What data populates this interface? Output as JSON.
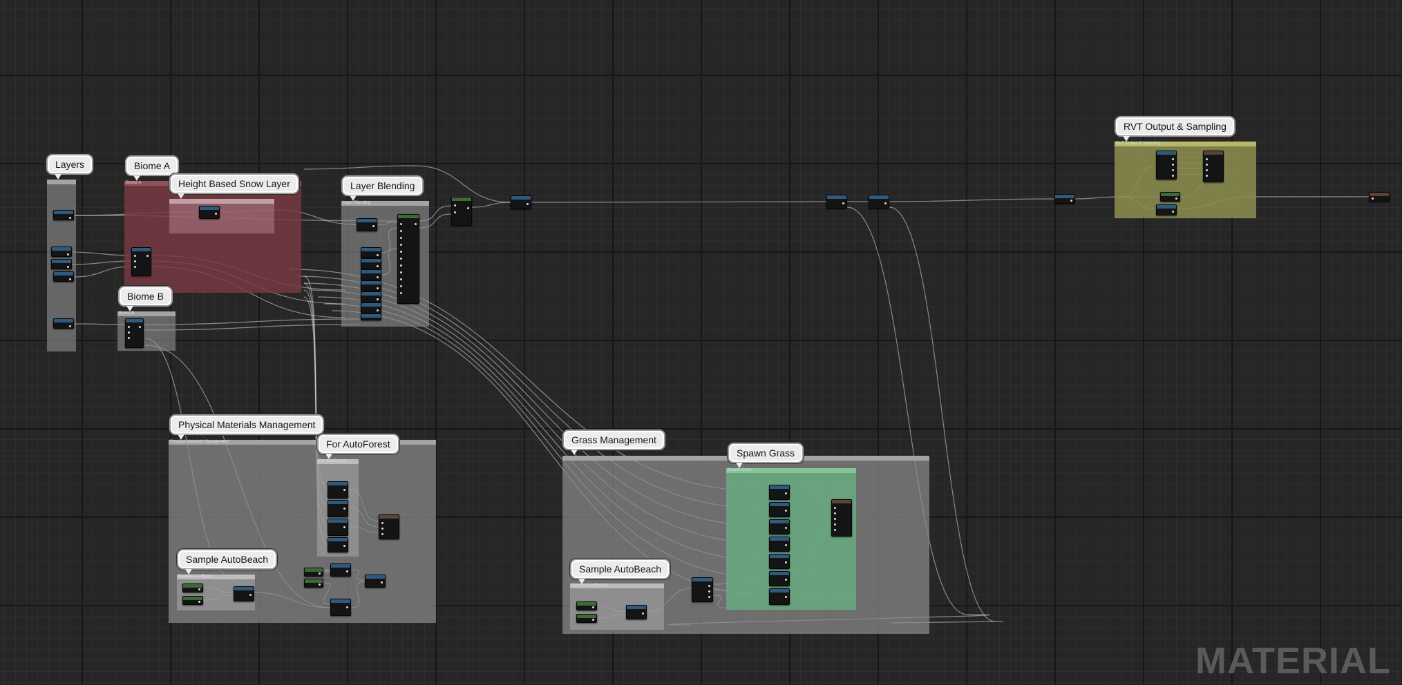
{
  "comments": [
    {
      "key": "layers",
      "label": "Layers",
      "tab_text": ""
    },
    {
      "key": "biome_a",
      "label": "Biome A",
      "tab_text": "Biome A"
    },
    {
      "key": "snow",
      "label": "Height Based Snow Layer",
      "tab_text": ""
    },
    {
      "key": "biome_b",
      "label": "Biome B",
      "tab_text": "Biome B"
    },
    {
      "key": "blend",
      "label": "Layer Blending",
      "tab_text": "Layer Blending"
    },
    {
      "key": "rvt",
      "label": "RVT Output & Sampling",
      "tab_text": "RVT Output & Sampling"
    },
    {
      "key": "phys",
      "label": "Physical Materials Management",
      "tab_text": "Physical Materials Management"
    },
    {
      "key": "forest",
      "label": "For AutoForest",
      "tab_text": "For AutoForest"
    },
    {
      "key": "beach1",
      "label": "Sample AutoBeach",
      "tab_text": "Sample AutoBeach"
    },
    {
      "key": "grass",
      "label": "Grass Management",
      "tab_text": ""
    },
    {
      "key": "spawn",
      "label": "Spawn Grass",
      "tab_text": "Spawn Grass"
    },
    {
      "key": "beach2",
      "label": "Sample AutoBeach",
      "tab_text": "Sample AutoBeach"
    }
  ],
  "colors": {
    "canvas_background": "#262626",
    "comment_default": "#8a8a8a",
    "comment_biome_a": "#7a3942",
    "comment_rvt": "#8a8a4a",
    "comment_spawn_grass": "#6aaa82",
    "node_header_blue": "#2f5a80",
    "node_header_green": "#3d6a35",
    "node_header_brown": "#5a4433",
    "wire": "#d8d8d8"
  },
  "watermark": "MATERIAL"
}
